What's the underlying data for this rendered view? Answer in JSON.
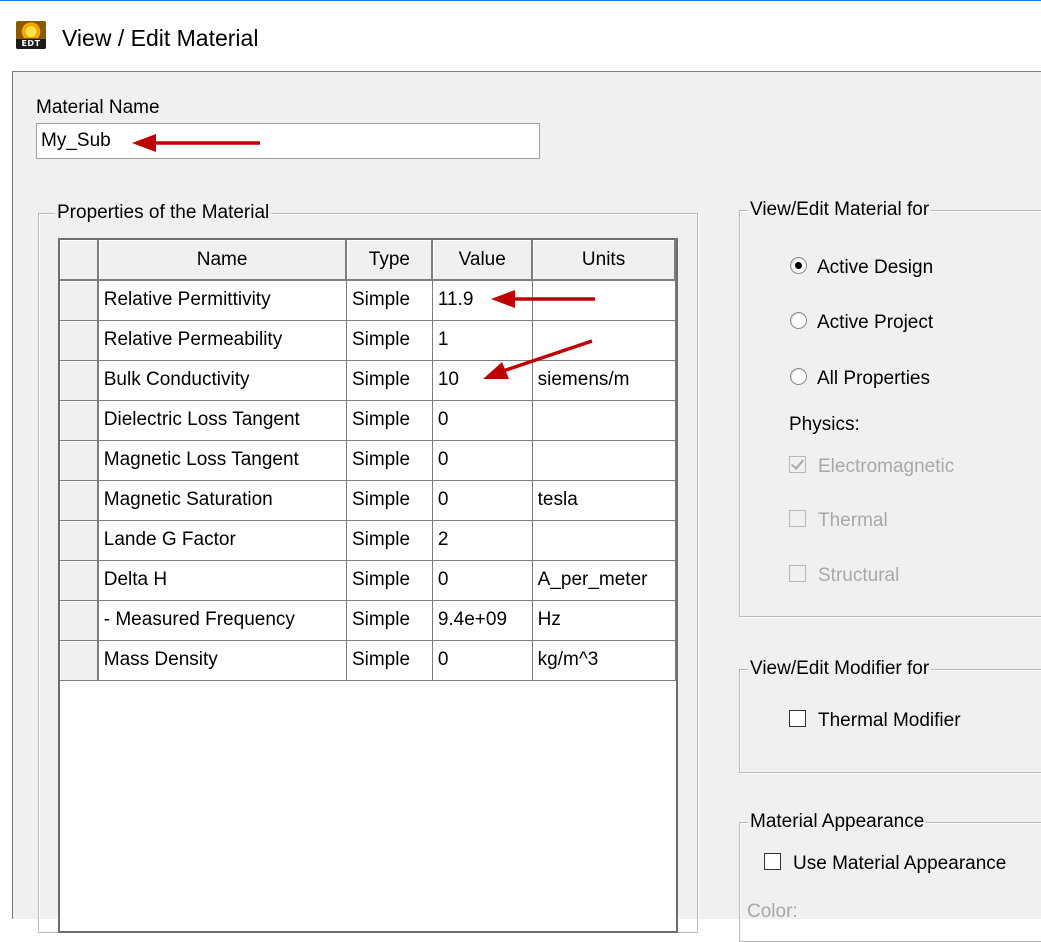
{
  "window": {
    "title": "View / Edit Material",
    "icon": "edt-app-icon",
    "icon_text": "EDT"
  },
  "material_name": {
    "label": "Material Name",
    "value": "My_Sub"
  },
  "properties": {
    "group_title": "Properties of the Material",
    "columns": [
      "Name",
      "Type",
      "Value",
      "Units"
    ],
    "rows": [
      {
        "name": "Relative Permittivity",
        "type": "Simple",
        "value": "11.9",
        "units": ""
      },
      {
        "name": "Relative Permeability",
        "type": "Simple",
        "value": "1",
        "units": ""
      },
      {
        "name": "Bulk Conductivity",
        "type": "Simple",
        "value": "10",
        "units": "siemens/m"
      },
      {
        "name": "Dielectric Loss Tangent",
        "type": "Simple",
        "value": "0",
        "units": ""
      },
      {
        "name": "Magnetic Loss Tangent",
        "type": "Simple",
        "value": "0",
        "units": ""
      },
      {
        "name": "Magnetic Saturation",
        "type": "Simple",
        "value": "0",
        "units": "tesla"
      },
      {
        "name": "Lande G Factor",
        "type": "Simple",
        "value": "2",
        "units": ""
      },
      {
        "name": "Delta H",
        "type": "Simple",
        "value": "0",
        "units": "A_per_meter"
      },
      {
        "name": "-  Measured Frequency",
        "type": "Simple",
        "value": "9.4e+09",
        "units": "Hz"
      },
      {
        "name": "Mass Density",
        "type": "Simple",
        "value": "0",
        "units": "kg/m^3"
      }
    ]
  },
  "view_edit_for": {
    "group_title": "View/Edit Material for",
    "options": [
      {
        "label": "Active Design",
        "selected": true
      },
      {
        "label": "Active Project",
        "selected": false
      },
      {
        "label": "All Properties",
        "selected": false
      }
    ],
    "physics_label": "Physics:",
    "physics": [
      {
        "label": "Electromagnetic",
        "checked": true,
        "enabled": false
      },
      {
        "label": "Thermal",
        "checked": false,
        "enabled": false
      },
      {
        "label": "Structural",
        "checked": false,
        "enabled": false
      }
    ]
  },
  "modifier_for": {
    "group_title": "View/Edit Modifier for",
    "thermal_modifier_label": "Thermal Modifier",
    "thermal_modifier_checked": false
  },
  "appearance": {
    "group_title": "Material Appearance",
    "use_label": "Use Material Appearance",
    "use_checked": false,
    "color_label": "Color:"
  },
  "annotation_color": "#c00000"
}
